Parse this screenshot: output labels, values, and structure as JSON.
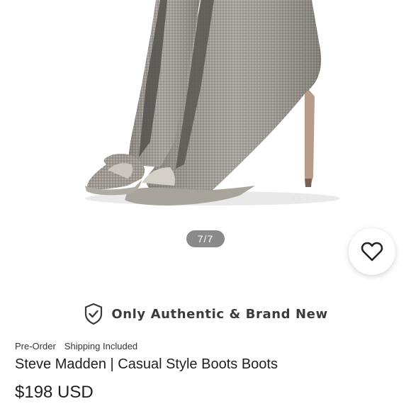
{
  "gallery": {
    "image_alt": "Silver rhinestone peep-toe stiletto ankle boots",
    "pager": "7/7"
  },
  "favorite": {
    "icon": "heart-icon"
  },
  "banner": {
    "icon": "shield-check-icon",
    "text": "Only Authentic & Brand New"
  },
  "product": {
    "tags": [
      "Pre-Order",
      "Shipping Included"
    ],
    "title": "Steve Madden | Casual Style Boots Boots",
    "price": "$198 USD"
  },
  "colors": {
    "pager_bg": "#8a8a8a",
    "text": "#1f1f1f",
    "boot": "#9a968f"
  }
}
